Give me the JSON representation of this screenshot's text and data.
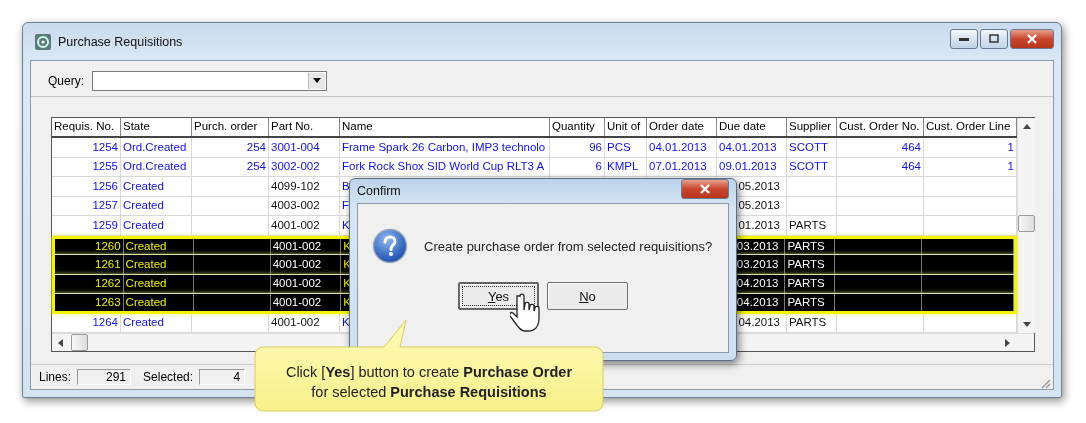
{
  "window": {
    "title": "Purchase Requisitions"
  },
  "query": {
    "label": "Query:"
  },
  "table": {
    "columns": [
      "Requis. No.",
      "State",
      "Purch. order",
      "Part No.",
      "Name",
      "Quantity",
      "Unit of",
      "Order date",
      "Due date",
      "Supplier",
      "Cust. Order No.",
      "Cust. Order Line"
    ],
    "rows": [
      {
        "kind": "ordered",
        "selected": false,
        "covered": false,
        "cells": [
          "1254",
          "Ord.Created",
          "254",
          "3001-004",
          "Frame Spark 26 Carbon, IMP3 technolo",
          "96",
          "PCS",
          "04.01.2013",
          "04.01.2013",
          "SCOTT",
          "464",
          "1"
        ]
      },
      {
        "kind": "ordered",
        "selected": false,
        "covered": false,
        "cells": [
          "1255",
          "Ord.Created",
          "254",
          "3002-002",
          "Fork Rock Shox SID World Cup RLT3 A",
          "6",
          "KMPL",
          "07.01.2013",
          "09.01.2013",
          "SCOTT",
          "464",
          "1"
        ]
      },
      {
        "kind": "created",
        "selected": false,
        "covered": true,
        "cells": [
          "1256",
          "Created",
          null,
          "4099-102",
          "B",
          null,
          null,
          null,
          "05.2013",
          null,
          null,
          null
        ]
      },
      {
        "kind": "created",
        "selected": false,
        "covered": true,
        "cells": [
          "1257",
          "Created",
          null,
          "4003-002",
          "F",
          null,
          null,
          null,
          "05.2013",
          null,
          null,
          null
        ]
      },
      {
        "kind": "created",
        "selected": false,
        "covered": true,
        "cells": [
          "1259",
          "Created",
          null,
          "4001-002",
          "K",
          null,
          null,
          null,
          "01.2013",
          "PARTS",
          null,
          null
        ]
      },
      {
        "kind": "created",
        "selected": true,
        "covered": true,
        "cells": [
          "1260",
          "Created",
          null,
          "4001-002",
          "K",
          null,
          null,
          null,
          "03.2013",
          "PARTS",
          null,
          null
        ]
      },
      {
        "kind": "created",
        "selected": true,
        "covered": true,
        "cells": [
          "1261",
          "Created",
          null,
          "4001-002",
          "K",
          null,
          null,
          null,
          "03.2013",
          "PARTS",
          null,
          null
        ]
      },
      {
        "kind": "created",
        "selected": true,
        "covered": true,
        "cells": [
          "1262",
          "Created",
          null,
          "4001-002",
          "K",
          null,
          null,
          null,
          "04.2013",
          "PARTS",
          null,
          null
        ]
      },
      {
        "kind": "created",
        "selected": true,
        "covered": true,
        "cells": [
          "1263",
          "Created",
          null,
          "4001-002",
          "K",
          null,
          null,
          null,
          "04.2013",
          "PARTS",
          null,
          null
        ]
      },
      {
        "kind": "created",
        "selected": false,
        "covered": true,
        "cells": [
          "1264",
          "Created",
          null,
          "4001-002",
          "K",
          null,
          null,
          null,
          "04.2013",
          "PARTS",
          null,
          null
        ]
      }
    ]
  },
  "status_bar": {
    "lines_label": "Lines:",
    "lines": "291",
    "selected_label": "Selected:",
    "selected": "4"
  },
  "dialog": {
    "title": "Confirm",
    "message": "Create purchase order from selected requisitions?",
    "buttons": [
      {
        "label": "Yes",
        "focused": true
      },
      {
        "label": "No",
        "focused": false
      }
    ]
  },
  "callout": {
    "text": "Click [**Yes**] button to create **Purchase Order** for selected **Purchase Requisitions**"
  }
}
